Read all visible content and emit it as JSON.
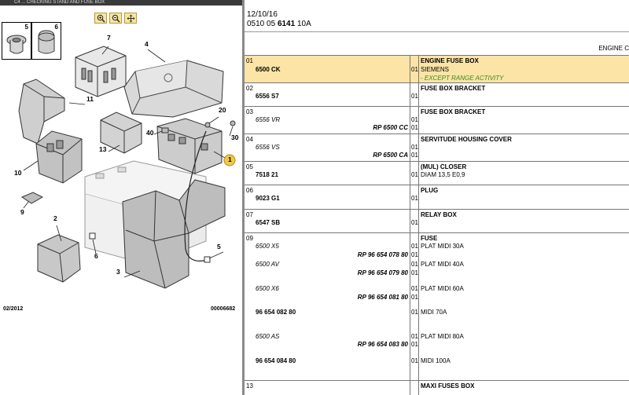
{
  "window": {
    "title": "C4 ... CHECKING STAND AND FUSE BOX"
  },
  "diagram": {
    "thumbnails": [
      {
        "label": "5"
      },
      {
        "label": "6"
      }
    ],
    "labels": {
      "l1": "1",
      "l2": "2",
      "l3": "3",
      "l4": "4",
      "l5": "5",
      "l6": "6",
      "l7": "7",
      "l9": "9",
      "l10": "10",
      "l11": "11",
      "l13": "13",
      "l20": "20",
      "l30": "30",
      "l40": "40"
    },
    "date_code": "02/2012",
    "drawing_number": "00006682",
    "toolbar_icons": [
      "zoom-in-icon",
      "zoom-out-icon",
      "pan-icon"
    ]
  },
  "header": {
    "date": "12/10/16",
    "ref_prefix": "0510 05 ",
    "ref_bold": "6141",
    "ref_suffix": " 10A",
    "engine_label": "ENGINE C"
  },
  "rows": [
    {
      "no": "01",
      "part": "6500 CK",
      "qty": "01",
      "title": "ENGINE FUSE BOX",
      "desc": "SIEMENS",
      "note": "- EXCEPT RANGE ACTIVITY"
    },
    {
      "no": "02",
      "part": "6556 S7",
      "qty": "01",
      "title": "FUSE BOX BRACKET"
    },
    {
      "no": "03",
      "alt": "6556 VR",
      "alt_qty": "01",
      "rp": "RP 6500 CC",
      "rp_qty": "01",
      "title": "FUSE BOX BRACKET"
    },
    {
      "no": "04",
      "alt": "6556 VS",
      "alt_qty": "01",
      "rp": "RP 6500 CA",
      "rp_qty": "01",
      "title": "SERVITUDE HOUSING COVER"
    },
    {
      "no": "05",
      "part": "7518 21",
      "qty": "01",
      "title": "(MUL) CLOSER",
      "desc": "DIAM 13,5 E0,9"
    },
    {
      "no": "06",
      "part": "9023 G1",
      "qty": "01",
      "title": "PLUG"
    },
    {
      "no": "07",
      "part": "6547 SB",
      "qty": "01",
      "title": "RELAY BOX"
    },
    {
      "no": "09",
      "title": "FUSE",
      "items": [
        {
          "alt": "6500 X5",
          "alt_qty": "01",
          "desc": "PLAT MIDI 30A",
          "rp": "RP 96 654 078 80",
          "rp_qty": "01"
        },
        {
          "alt": "6500 AV",
          "alt_qty": "01",
          "desc": "PLAT MIDI 40A",
          "rp": "RP 96 654 079 80",
          "rp_qty": "01"
        },
        {
          "alt": "6500 X6",
          "alt_qty": "01",
          "desc": "PLAT MIDI 60A",
          "rp": "RP 96 654 081 80",
          "rp_qty": "01"
        },
        {
          "part": "96 654 082 80",
          "qty": "01",
          "desc": "MIDI 70A"
        },
        {
          "alt": "6500 AS",
          "alt_qty": "01",
          "desc": "PLAT MIDI 80A",
          "rp": "RP 96 654 083 80",
          "rp_qty": "01"
        },
        {
          "part": "96 654 084 80",
          "qty": "01",
          "desc": "MIDI 100A"
        }
      ]
    },
    {
      "no": "13",
      "title": "MAXI FUSES BOX"
    }
  ]
}
